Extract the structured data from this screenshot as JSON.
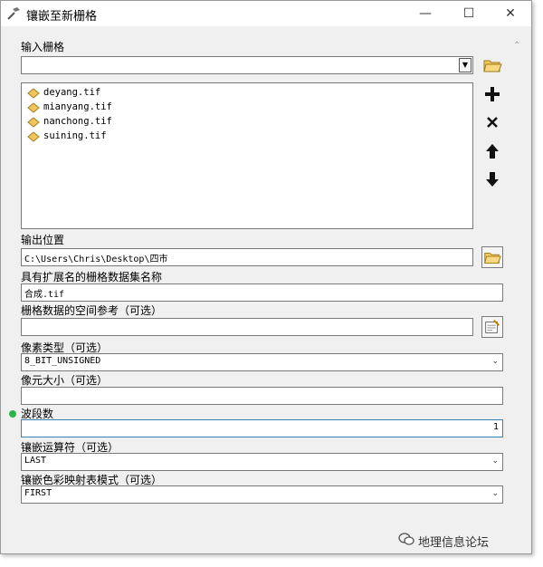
{
  "window": {
    "title": "镶嵌至新栅格"
  },
  "input_rasters": {
    "label": "输入栅格",
    "value": "",
    "files": [
      "deyang.tif",
      "mianyang.tif",
      "nanchong.tif",
      "suining.tif"
    ]
  },
  "output_location": {
    "label": "输出位置",
    "value": "C:\\Users\\Chris\\Desktop\\四市"
  },
  "dataset_name": {
    "label": "具有扩展名的栅格数据集名称",
    "value": "合成.tif"
  },
  "spatial_reference": {
    "label": "栅格数据的空间参考（可选）",
    "value": ""
  },
  "pixel_type": {
    "label": "像素类型（可选）",
    "value": "8_BIT_UNSIGNED"
  },
  "cell_size": {
    "label": "像元大小（可选）",
    "value": ""
  },
  "band_count": {
    "label": "波段数",
    "value": "1"
  },
  "mosaic_operator": {
    "label": "镶嵌运算符（可选）",
    "value": "LAST"
  },
  "colormap_mode": {
    "label": "镶嵌色彩映射表模式（可选）",
    "value": "FIRST"
  },
  "watermark": {
    "text": "地理信息论坛"
  },
  "colors": {
    "required_dot": "#2fb34a",
    "folder": "#f2c75c"
  }
}
